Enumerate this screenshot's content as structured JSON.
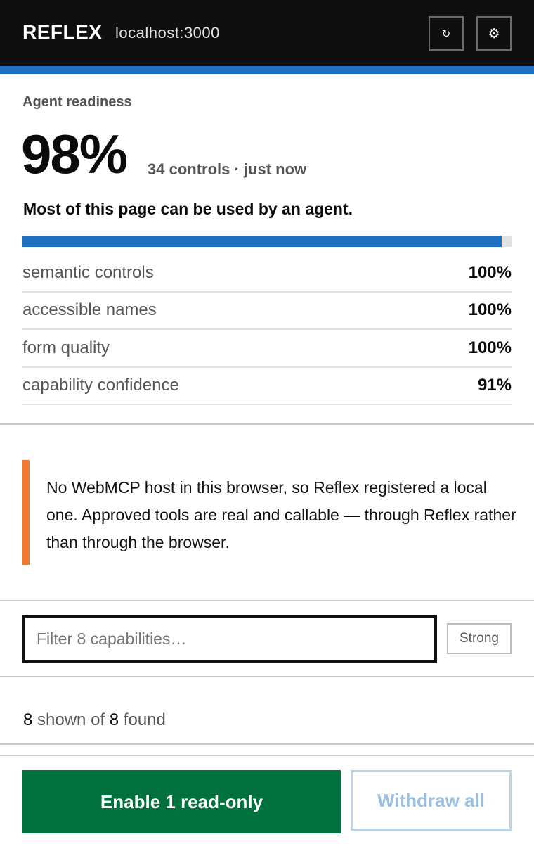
{
  "header": {
    "brand": "REFLEX",
    "host": "localhost:3000",
    "refresh_icon": "↻",
    "settings_icon": "⚙"
  },
  "readiness": {
    "label": "Agent readiness",
    "score": "98%",
    "meta": "34 controls · just now",
    "headline": "Most of this page can be used by an agent.",
    "progress_fraction": 0.98
  },
  "metrics": [
    {
      "name": "semantic controls",
      "value": "100%"
    },
    {
      "name": "accessible names",
      "value": "100%"
    },
    {
      "name": "form quality",
      "value": "100%"
    },
    {
      "name": "capability confidence",
      "value": "91%"
    }
  ],
  "notice": {
    "text": "No WebMCP host in this browser, so Reflex registered a local one. Approved tools are real and callable — through Reflex rather than through the browser."
  },
  "filter": {
    "placeholder": "Filter 8 capabilities…",
    "value": "",
    "strength_label": "Strong"
  },
  "counts": {
    "shown": "8",
    "shown_label": "shown of",
    "found": "8",
    "found_label": "found"
  },
  "actions": {
    "enable_label": "Enable 1 read-only",
    "withdraw_label": "Withdraw all"
  },
  "colors": {
    "accent_blue": "#1e6fc2",
    "warning_orange": "#f07a32",
    "primary_green": "#00703c"
  }
}
